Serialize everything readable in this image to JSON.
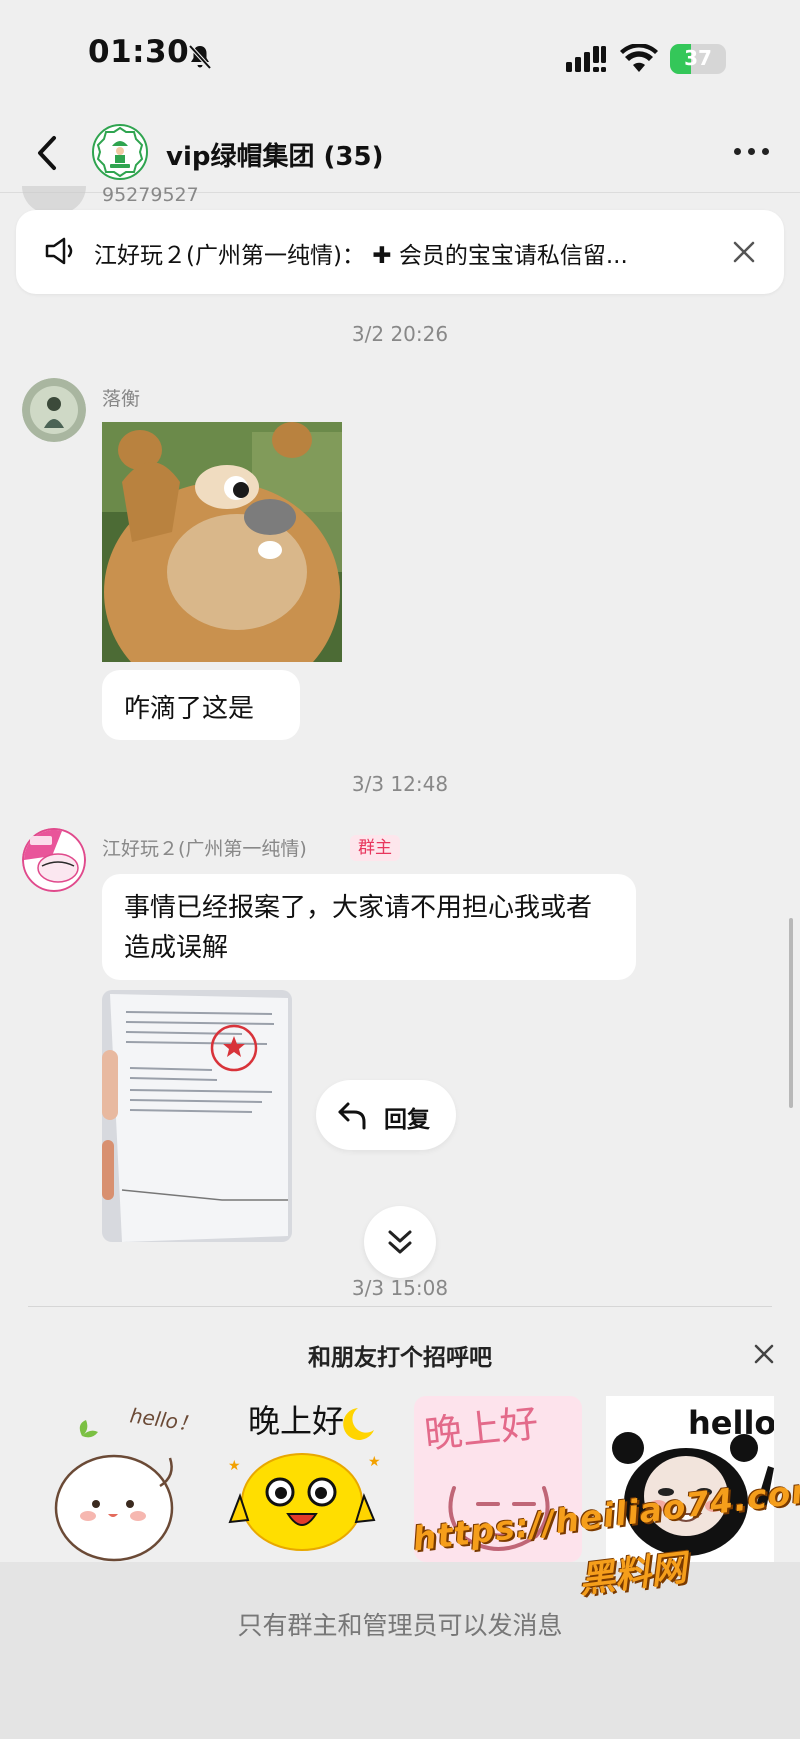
{
  "status_bar": {
    "time": "01:30",
    "battery": "37",
    "battery_level": 0.37
  },
  "header": {
    "title": "vip绿帽集团 (35)"
  },
  "peek": {
    "text": "95279527"
  },
  "announcement": {
    "text": "江好玩２(广州第一纯情)：  ✚ 会员的宝宝请私信留..."
  },
  "messages": {
    "ts1": "3/2 20:26",
    "msg1": {
      "sender": "落衡",
      "text": "咋滴了这是"
    },
    "ts2": "3/3 12:48",
    "msg2": {
      "sender": "江好玩２(广州第一纯情)",
      "badge": "群主",
      "text": "事情已经报案了，大家请不用担心我或者造成误解"
    },
    "ts3": "3/3 15:08"
  },
  "reply_label": "回复",
  "greeting": {
    "title": "和朋友打个招呼吧",
    "stickers": [
      {
        "name": "hello-bun",
        "caption": "hello！"
      },
      {
        "name": "good-evening-smiley",
        "caption": "晚上好"
      },
      {
        "name": "good-evening-pink",
        "caption": "晚上好"
      },
      {
        "name": "hello-panda",
        "caption": "hello"
      }
    ]
  },
  "bottom": {
    "notice": "只有群主和管理员可以发消息"
  },
  "watermark": {
    "url": "https://heiliao74.com",
    "name": "黑料网"
  },
  "colors": {
    "accent_green": "#34c759",
    "owner_badge": "#e8365d",
    "watermark": "#f59e1b"
  }
}
